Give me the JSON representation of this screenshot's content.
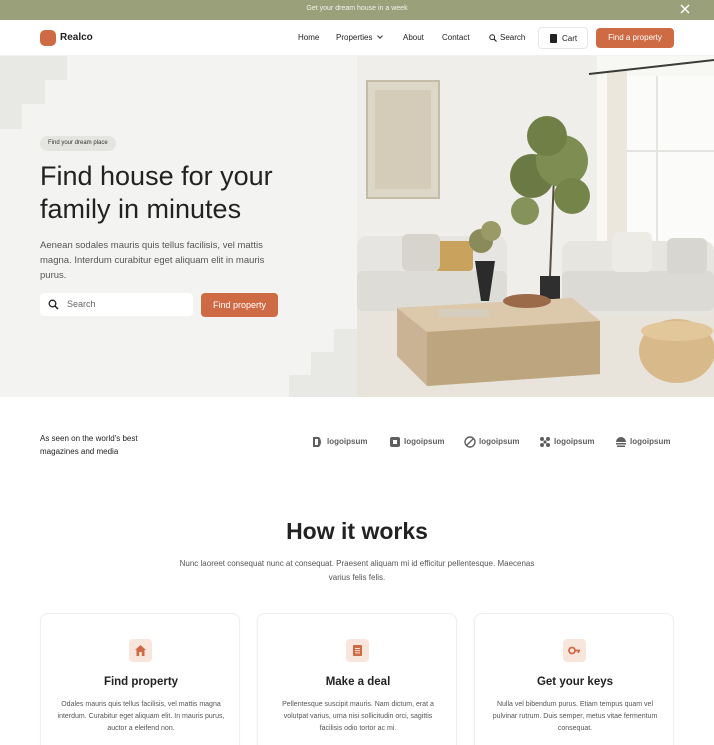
{
  "announcement": {
    "text": "Get your dream house in a week",
    "close_icon": "close-icon"
  },
  "nav": {
    "brand": "Realco",
    "links": [
      "Home",
      "Properties",
      "About",
      "Contact"
    ],
    "search_label": "Search",
    "cart_label": "Cart",
    "cta_label": "Find a property"
  },
  "hero": {
    "badge": "Find your dream place",
    "title": "Find house for your family in minutes",
    "description": "Aenean sodales mauris quis tellus facilisis, vel mattis magna. Interdum curabitur eget aliquam elit in mauris purus.",
    "search_placeholder": "Search",
    "button_label": "Find property"
  },
  "seen": {
    "text": "As seen on the world's best magazines and media",
    "logos": [
      "logoipsum",
      "logoipsum",
      "logoipsum",
      "logoipsum",
      "logoipsum"
    ]
  },
  "how": {
    "title": "How it works",
    "description": "Nunc laoreet consequat nunc at consequat. Praesent aliquam mi id efficitur pellentesque. Maecenas varius felis felis.",
    "cards": [
      {
        "icon": "home-icon",
        "title": "Find property",
        "text": "Odales mauris quis tellus facilisis, vel mattis magna interdum. Curabitur eget aliquam elit. In mauris purus, auctor a eleifend non."
      },
      {
        "icon": "document-icon",
        "title": "Make a deal",
        "text": "Pellentesque suscipit mauris. Nam dictum, erat a volutpat varius, urna nisi sollicitudin orci, sagittis facilisis odio tortor ac mi."
      },
      {
        "icon": "key-icon",
        "title": "Get your keys",
        "text": "Nulla vel bibendum purus. Etiam tempus quam vel pulvinar rutrum. Duis semper, metus vitae fermentum consequat."
      }
    ]
  },
  "colors": {
    "accent": "#cf6b44",
    "announcement_bg": "#9aa07a",
    "hero_bg": "#f3f3f1"
  }
}
